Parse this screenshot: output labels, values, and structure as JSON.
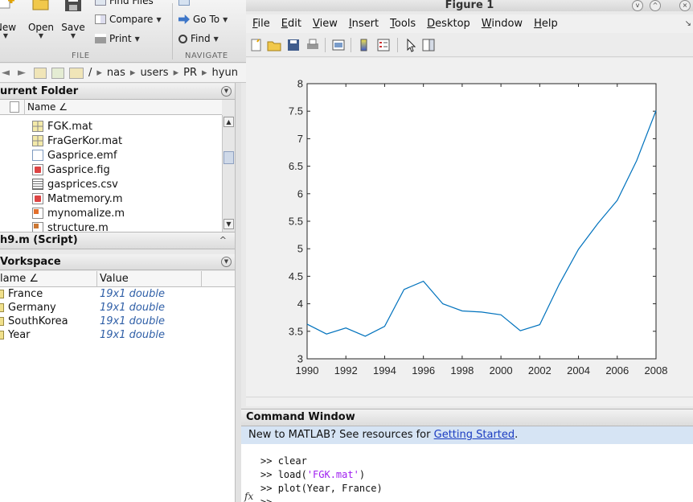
{
  "toolstrip": {
    "new_label": "New",
    "open_label": "Open",
    "save_label": "Save",
    "find_files_label": "Find Files",
    "compare_label": "Compare",
    "print_label": "Print",
    "file_group": "FILE",
    "go_to_label": "Go To",
    "find_label": "Find",
    "navigate_group": "NAVIGATE"
  },
  "path": {
    "segments": [
      "/",
      "nas",
      "users",
      "PR",
      "hyun"
    ]
  },
  "current_folder": {
    "title": "urrent Folder",
    "column": "Name ∠",
    "files": [
      {
        "name": "FGK.mat",
        "icon": "mat-file-icon"
      },
      {
        "name": "FraGerKor.mat",
        "icon": "mat-file-icon"
      },
      {
        "name": "Gasprice.emf",
        "icon": "emf-file-icon"
      },
      {
        "name": "Gasprice.fig",
        "icon": "fig-file-icon"
      },
      {
        "name": "gasprices.csv",
        "icon": "csv-file-icon"
      },
      {
        "name": "Matmemory.m",
        "icon": "m-file-icon"
      },
      {
        "name": "mynomalize.m",
        "icon": "m-file-icon"
      },
      {
        "name": "structure.m",
        "icon": "m-file-icon"
      }
    ]
  },
  "script_panel": {
    "title": "h9.m  (Script)"
  },
  "workspace": {
    "title": "Vorkspace",
    "col_name": "lame ∠",
    "col_value": "Value",
    "rows": [
      {
        "name": "France",
        "value": "19x1 double"
      },
      {
        "name": "Germany",
        "value": "19x1 double"
      },
      {
        "name": "SouthKorea",
        "value": "19x1 double"
      },
      {
        "name": "Year",
        "value": "19x1 double"
      }
    ]
  },
  "figure": {
    "title": "Figure 1",
    "menus": [
      {
        "label": "File",
        "u": "F",
        "rest": "ile"
      },
      {
        "label": "Edit",
        "u": "E",
        "rest": "dit"
      },
      {
        "label": "View",
        "u": "V",
        "rest": "iew"
      },
      {
        "label": "Insert",
        "u": "I",
        "rest": "nsert"
      },
      {
        "label": "Tools",
        "u": "T",
        "rest": "ools"
      },
      {
        "label": "Desktop",
        "u": "D",
        "rest": "esktop"
      },
      {
        "label": "Window",
        "u": "W",
        "rest": "indow"
      },
      {
        "label": "Help",
        "u": "H",
        "rest": "elp"
      }
    ]
  },
  "chart_data": {
    "type": "line",
    "x": [
      1990,
      1991,
      1992,
      1993,
      1994,
      1995,
      1996,
      1997,
      1998,
      1999,
      2000,
      2001,
      2002,
      2003,
      2004,
      2005,
      2006,
      2007,
      2008
    ],
    "series": [
      {
        "values": [
          3.63,
          3.45,
          3.56,
          3.41,
          3.59,
          4.26,
          4.41,
          4.0,
          3.87,
          3.85,
          3.8,
          3.51,
          3.62,
          4.35,
          4.99,
          5.46,
          5.88,
          6.6,
          7.51
        ],
        "color": "#0072bd"
      }
    ],
    "xlim": [
      1990,
      2008
    ],
    "ylim": [
      3,
      8
    ],
    "xticks": [
      1990,
      1992,
      1994,
      1996,
      1998,
      2000,
      2002,
      2004,
      2006,
      2008
    ],
    "yticks": [
      3,
      3.5,
      4,
      4.5,
      5,
      5.5,
      6,
      6.5,
      7,
      7.5,
      8
    ],
    "grid": false,
    "title": "",
    "xlabel": "",
    "ylabel": ""
  },
  "command_window": {
    "title": "Command Window",
    "banner_text": "New to MATLAB? See resources for ",
    "banner_link": "Getting Started",
    "banner_end": ".",
    "lines": [
      {
        "prompt": ">> ",
        "code": "clear",
        "str": "",
        "tail": ""
      },
      {
        "prompt": ">> ",
        "code": "load(",
        "str": "'FGK.mat'",
        "tail": ")"
      },
      {
        "prompt": ">> ",
        "code": "plot(Year, France)",
        "str": "",
        "tail": ""
      },
      {
        "prompt": ">> ",
        "code": "",
        "str": "",
        "tail": ""
      }
    ],
    "fx": "fx"
  }
}
